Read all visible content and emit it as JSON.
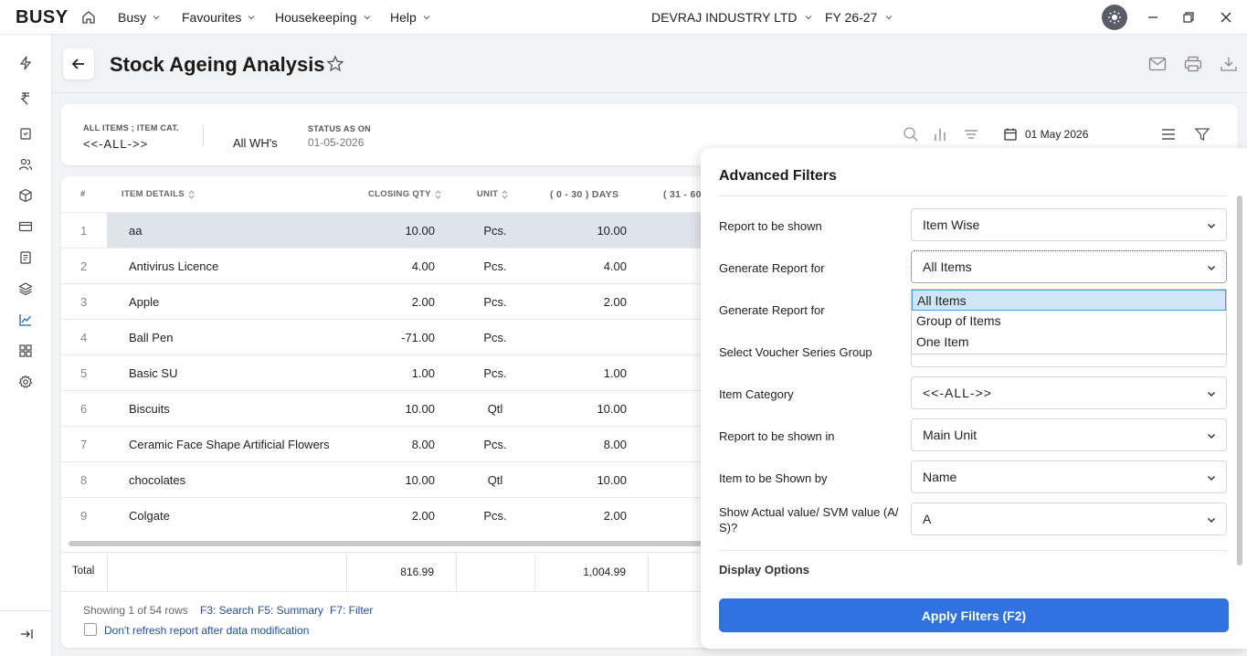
{
  "app": {
    "logo": "BUSY",
    "menus": [
      "Busy",
      "Favourites",
      "Housekeeping",
      "Help"
    ],
    "company": "DEVRAJ INDUSTRY LTD",
    "fy": "FY 26-27"
  },
  "page": {
    "title": "Stock Ageing Analysis"
  },
  "summary": {
    "items_label": "ALL ITEMS ; ITEM CAT.",
    "items_value": "<<-ALL->>",
    "wh_value": "All WH's",
    "status_label": "STATUS AS ON",
    "status_value": "01-05-2026",
    "date": "01 May 2026"
  },
  "table": {
    "headers": {
      "idx": "#",
      "item": "ITEM DETAILS",
      "qty": "CLOSING QTY",
      "unit": "UNIT",
      "b1": "( 0 - 30 ) DAYS",
      "b2": "( 31 - 60"
    },
    "rows": [
      {
        "n": "1",
        "item": "aa",
        "qty": "10.00",
        "unit": "Pcs.",
        "b1": "10.00"
      },
      {
        "n": "2",
        "item": "Antivirus Licence",
        "qty": "4.00",
        "unit": "Pcs.",
        "b1": "4.00"
      },
      {
        "n": "3",
        "item": "Apple",
        "qty": "2.00",
        "unit": "Pcs.",
        "b1": "2.00"
      },
      {
        "n": "4",
        "item": "Ball Pen",
        "qty": "-71.00",
        "unit": "Pcs.",
        "b1": ""
      },
      {
        "n": "5",
        "item": "Basic SU",
        "qty": "1.00",
        "unit": "Pcs.",
        "b1": "1.00"
      },
      {
        "n": "6",
        "item": "Biscuits",
        "qty": "10.00",
        "unit": "Qtl",
        "b1": "10.00"
      },
      {
        "n": "7",
        "item": "Ceramic Face Shape Artificial Flowers",
        "qty": "8.00",
        "unit": "Pcs.",
        "b1": "8.00"
      },
      {
        "n": "8",
        "item": "chocolates",
        "qty": "10.00",
        "unit": "Qtl",
        "b1": "10.00"
      },
      {
        "n": "9",
        "item": "Colgate",
        "qty": "2.00",
        "unit": "Pcs.",
        "b1": "2.00"
      }
    ],
    "total_label": "Total",
    "total_qty": "816.99",
    "total_b1": "1,004.99"
  },
  "footer": {
    "showing": "Showing 1 of 54 rows",
    "f3": "F3: Search",
    "f5": "F5: Summary",
    "f7": "F7: Filter",
    "refresh_label": "Don't refresh report after data modification"
  },
  "panel": {
    "title": "Advanced Filters",
    "fields": [
      {
        "label": "Report to be shown",
        "value": "Item Wise"
      },
      {
        "label": "Generate Report for",
        "value": "All Items"
      },
      {
        "label": "Generate Report for",
        "value": ""
      },
      {
        "label": "Select Voucher Series Group",
        "value": ""
      },
      {
        "label": "Item Category",
        "value": "<<-ALL->>"
      },
      {
        "label": "Report to be shown in",
        "value": "Main Unit"
      },
      {
        "label": "Item to be Shown by",
        "value": "Name"
      },
      {
        "label": "Show Actual value/ SVM value (A/ S)?",
        "value": "A"
      }
    ],
    "dropdown_options": [
      "All Items",
      "Group of Items",
      "One Item"
    ],
    "display_options": "Display Options",
    "apply": "Apply Filters (F2)"
  },
  "colors": {
    "accent": "#2f72e0",
    "selected_row": "#dfe3ea",
    "highlight_option": "#cfe6f7"
  }
}
